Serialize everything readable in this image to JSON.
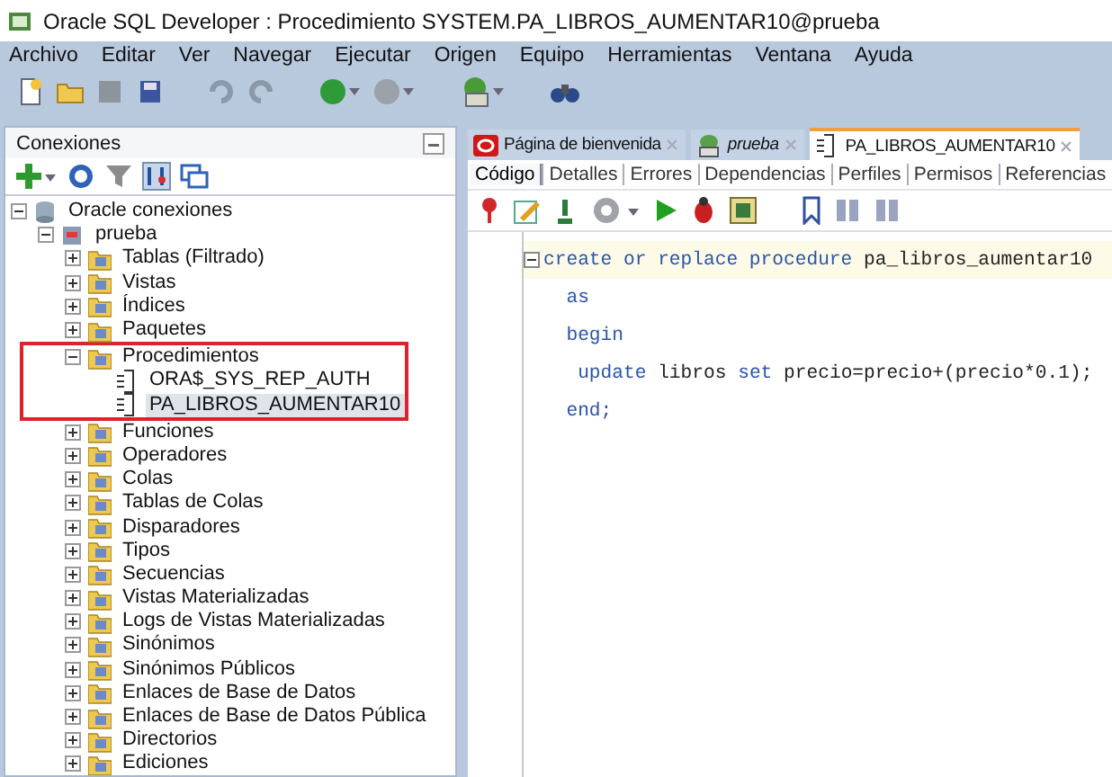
{
  "window": {
    "title": "Oracle SQL Developer : Procedimiento SYSTEM.PA_LIBROS_AUMENTAR10@prueba"
  },
  "menu": [
    "Archivo",
    "Editar",
    "Ver",
    "Navegar",
    "Ejecutar",
    "Origen",
    "Equipo",
    "Herramientas",
    "Ventana",
    "Ayuda"
  ],
  "connections_panel": {
    "title": "Conexiones",
    "tree": [
      {
        "label": "Oracle conexiones",
        "kind": "root",
        "expanded": true,
        "children": [
          {
            "label": "prueba",
            "kind": "connection",
            "expanded": true,
            "children": [
              {
                "label": "Tablas (Filtrado)",
                "kind": "folder",
                "expanded": false
              },
              {
                "label": "Vistas",
                "kind": "folder",
                "expanded": false
              },
              {
                "label": "Índices",
                "kind": "folder",
                "expanded": false
              },
              {
                "label": "Paquetes",
                "kind": "folder",
                "expanded": false
              },
              {
                "label": "Procedimientos",
                "kind": "folder",
                "expanded": true,
                "annotated": true,
                "children": [
                  {
                    "label": "ORA$_SYS_REP_AUTH",
                    "kind": "procedure",
                    "selected": false
                  },
                  {
                    "label": "PA_LIBROS_AUMENTAR10",
                    "kind": "procedure",
                    "selected": true
                  }
                ]
              },
              {
                "label": "Funciones",
                "kind": "folder",
                "expanded": false
              },
              {
                "label": "Operadores",
                "kind": "folder",
                "expanded": false
              },
              {
                "label": "Colas",
                "kind": "folder",
                "expanded": false
              },
              {
                "label": "Tablas de Colas",
                "kind": "folder",
                "expanded": false
              },
              {
                "label": "Disparadores",
                "kind": "folder",
                "expanded": false
              },
              {
                "label": "Tipos",
                "kind": "folder",
                "expanded": false
              },
              {
                "label": "Secuencias",
                "kind": "folder",
                "expanded": false
              },
              {
                "label": "Vistas Materializadas",
                "kind": "folder",
                "expanded": false
              },
              {
                "label": "Logs de Vistas Materializadas",
                "kind": "folder",
                "expanded": false
              },
              {
                "label": "Sinónimos",
                "kind": "folder",
                "expanded": false
              },
              {
                "label": "Sinónimos Públicos",
                "kind": "folder",
                "expanded": false
              },
              {
                "label": "Enlaces de Base de Datos",
                "kind": "folder",
                "expanded": false
              },
              {
                "label": "Enlaces de Base de Datos Pública",
                "kind": "folder",
                "expanded": false
              },
              {
                "label": "Directorios",
                "kind": "folder",
                "expanded": false
              },
              {
                "label": "Ediciones",
                "kind": "folder",
                "expanded": false
              }
            ]
          }
        ]
      }
    ]
  },
  "editor": {
    "tabs": [
      {
        "label": "Página de bienvenida",
        "kind": "welcome",
        "selected": false
      },
      {
        "label": "prueba",
        "kind": "connection",
        "selected": false
      },
      {
        "label": "PA_LIBROS_AUMENTAR10",
        "kind": "procedure",
        "selected": true
      }
    ],
    "subtabs": [
      {
        "label": "Código",
        "selected": true
      },
      {
        "label": "Detalles",
        "selected": false
      },
      {
        "label": "Errores",
        "selected": false
      },
      {
        "label": "Dependencias",
        "selected": false
      },
      {
        "label": "Perfiles",
        "selected": false
      },
      {
        "label": "Permisos",
        "selected": false
      },
      {
        "label": "Referencias",
        "selected": false
      }
    ],
    "code": [
      {
        "current": true,
        "tokens": [
          {
            "text": "create or replace procedure ",
            "kind": "keyword"
          },
          {
            "text": "pa_libros_aumentar10",
            "kind": "ident"
          }
        ]
      },
      {
        "current": false,
        "tokens": [
          {
            "text": "  as",
            "kind": "keyword"
          }
        ]
      },
      {
        "current": false,
        "tokens": [
          {
            "text": "  begin",
            "kind": "keyword"
          }
        ]
      },
      {
        "current": false,
        "tokens": [
          {
            "text": "   update ",
            "kind": "keyword"
          },
          {
            "text": "libros ",
            "kind": "ident"
          },
          {
            "text": "set ",
            "kind": "keyword"
          },
          {
            "text": "precio=precio+(precio*0.1);",
            "kind": "ident"
          }
        ]
      },
      {
        "current": false,
        "tokens": [
          {
            "text": "  end;",
            "kind": "keyword"
          }
        ]
      }
    ]
  }
}
